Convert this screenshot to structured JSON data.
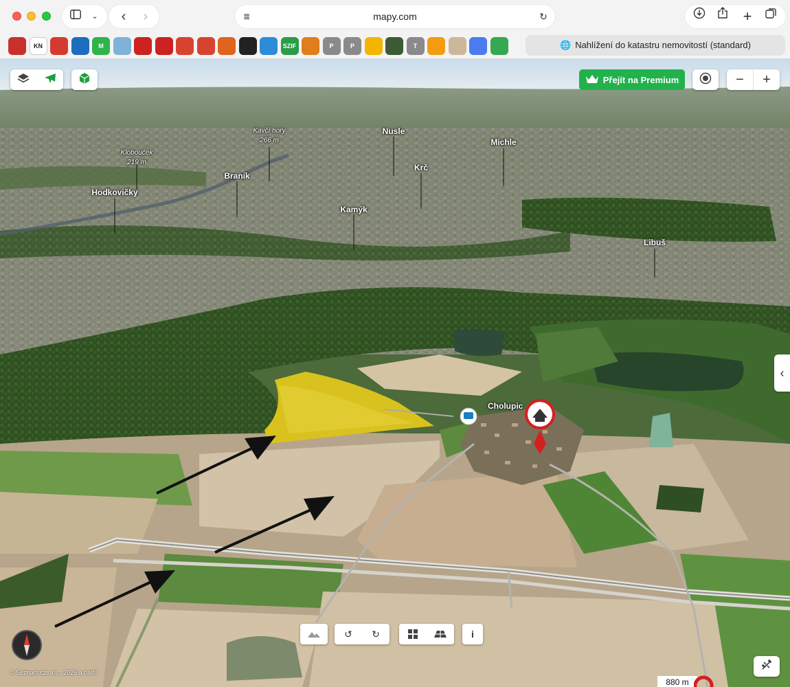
{
  "browser": {
    "url": "mapy.com",
    "bookmark_tab_title": "Nahlížení do katastru nemovitostí (standard)",
    "favorites": [
      {
        "name": "fav-1",
        "text": "",
        "color": "#c8312b"
      },
      {
        "name": "fav-kn",
        "text": "KN",
        "color": "#ffffff"
      },
      {
        "name": "fav-3",
        "text": "",
        "color": "#d43a2f"
      },
      {
        "name": "fav-4",
        "text": "",
        "color": "#1c6fbf"
      },
      {
        "name": "fav-m",
        "text": "M",
        "color": "#2fb34a"
      },
      {
        "name": "fav-6",
        "text": "",
        "color": "#7fb2d9"
      },
      {
        "name": "fav-7",
        "text": "",
        "color": "#c22"
      },
      {
        "name": "fav-8",
        "text": "",
        "color": "#c22"
      },
      {
        "name": "fav-9",
        "text": "",
        "color": "#d8432f"
      },
      {
        "name": "fav-10",
        "text": "",
        "color": "#d8432f"
      },
      {
        "name": "fav-11",
        "text": "",
        "color": "#e0631e"
      },
      {
        "name": "fav-12",
        "text": "",
        "color": "#222"
      },
      {
        "name": "fav-13",
        "text": "",
        "color": "#2c8cd8"
      },
      {
        "name": "fav-szif",
        "text": "SZIF",
        "color": "#2a9c47"
      },
      {
        "name": "fav-15",
        "text": "",
        "color": "#e07d1c"
      },
      {
        "name": "fav-p1",
        "text": "P",
        "color": "#8a8a8a"
      },
      {
        "name": "fav-p2",
        "text": "P",
        "color": "#8a8a8a"
      },
      {
        "name": "fav-18",
        "text": "",
        "color": "#f2b600"
      },
      {
        "name": "fav-19",
        "text": "",
        "color": "#3c5a34"
      },
      {
        "name": "fav-t",
        "text": "T",
        "color": "#8a8a8a"
      },
      {
        "name": "fav-21",
        "text": "",
        "color": "#f39c12"
      },
      {
        "name": "fav-22",
        "text": "",
        "color": "#cbb89a"
      },
      {
        "name": "fav-23",
        "text": "",
        "color": "#4a7cf0"
      },
      {
        "name": "fav-24",
        "text": "",
        "color": "#34a853"
      }
    ]
  },
  "map": {
    "premium_label": "Přejít na Premium",
    "zoom_out": "−",
    "zoom_in": "+",
    "places": {
      "kavci_hory": "Kavčí hory",
      "kavci_hory_elev": "266 m",
      "kloboucek": "Klobouček",
      "kloboucek_elev": "219 m",
      "nusle": "Nusle",
      "michle": "Michle",
      "branik": "Braník",
      "krc": "Krč",
      "hodkovicky": "Hodkovičky",
      "kamyk": "Kamýk",
      "libus": "Libuš",
      "cholupice": "Cholupic"
    },
    "copyright": "© Seznam.cz, a.s., 2026 a další",
    "scale": "880 m",
    "info_label": "i",
    "colors": {
      "premium": "#22b14c",
      "pin": "#d42020",
      "highlight_field": "#d9c21e"
    }
  }
}
